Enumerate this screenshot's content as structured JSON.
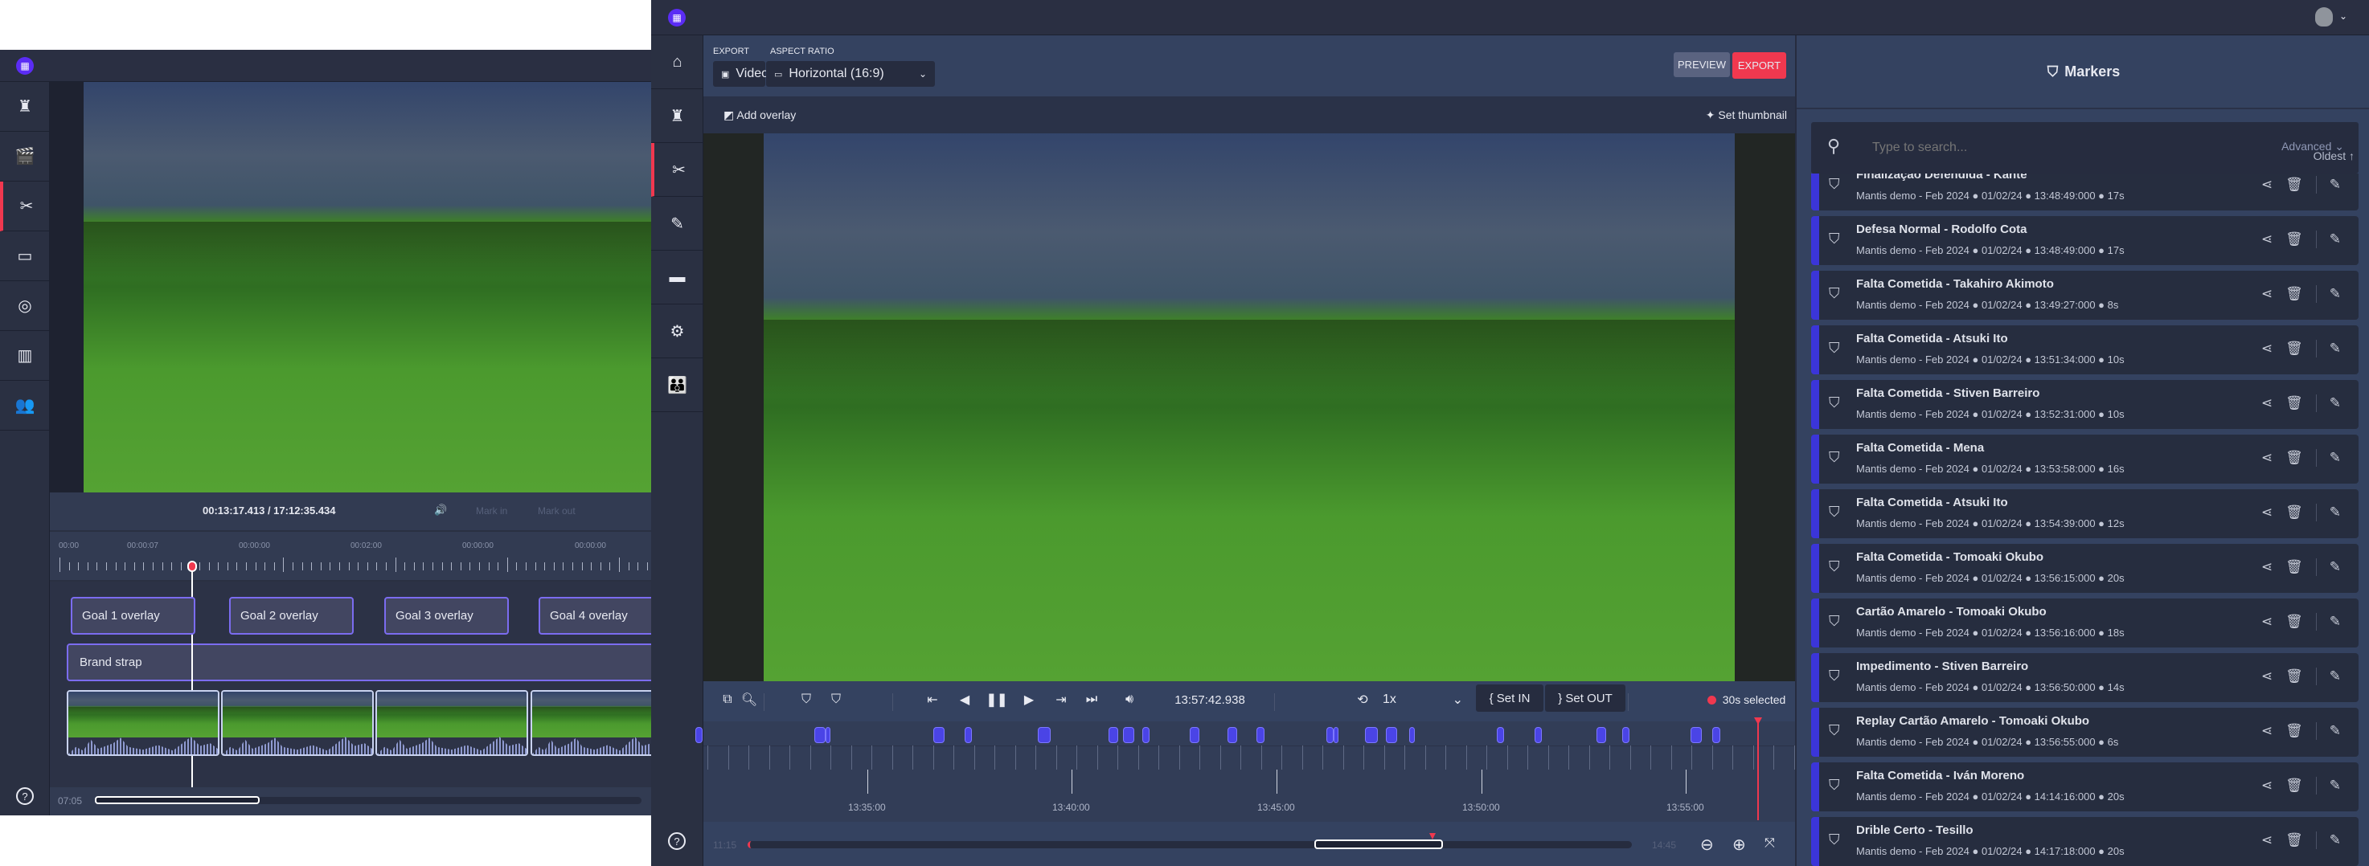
{
  "colors": {
    "accent": "#5b2cf5",
    "export": "#f0384f",
    "marker": "#4a44e6",
    "overlay_border": "#7b6cf0",
    "playhead": "#f0384f"
  },
  "left_app": {
    "sidebar": [
      {
        "icon": "director-chair-icon",
        "glyph": "♜"
      },
      {
        "icon": "clapperboard-icon",
        "glyph": "🎬"
      },
      {
        "icon": "clip-edit-icon",
        "glyph": "✂",
        "active": true
      },
      {
        "icon": "folder-icon",
        "glyph": "▭"
      },
      {
        "icon": "play-settings-icon",
        "glyph": "◎"
      },
      {
        "icon": "chart-icon",
        "glyph": "▥"
      },
      {
        "icon": "users-icon",
        "glyph": "👥"
      }
    ],
    "time_display": "00:13:17.413 / 17:12:35.434",
    "mark_in": "Mark in",
    "mark_out": "Mark out",
    "ruler_labels": [
      "00:00",
      "00:00:07",
      "00:00:00",
      "00:02:00",
      "00:00:00",
      "00:00:00"
    ],
    "overlays": [
      "Goal 1 overlay",
      "Goal 2 overlay",
      "Goal 3 overlay",
      "Goal 4 overlay"
    ],
    "brand_strap": "Brand strap",
    "scroll_start": "07:05",
    "help": "?"
  },
  "right_app": {
    "sidebar": [
      {
        "icon": "home-icon",
        "glyph": "⌂"
      },
      {
        "icon": "director-chair-icon",
        "glyph": "♜"
      },
      {
        "icon": "scissors-icon",
        "glyph": "✂",
        "active": true
      },
      {
        "icon": "edit-notebook-icon",
        "glyph": "✎"
      },
      {
        "icon": "folder-icon",
        "glyph": "▬"
      },
      {
        "icon": "video-settings-icon",
        "glyph": "⚙"
      },
      {
        "icon": "team-icon",
        "glyph": "👪"
      }
    ],
    "export_label": "EXPORT",
    "export_value": "Video",
    "aspect_label": "ASPECT RATIO",
    "aspect_value": "Horizontal (16:9)",
    "preview": "PREVIEW",
    "export_button": "EXPORT",
    "add_overlay": "Add overlay",
    "set_thumbnail": "Set thumbnail",
    "timecode": "13:57:42.938",
    "speed": "1x",
    "set_in": "Set IN",
    "set_out": "Set OUT",
    "selected": "30s selected",
    "timeline_labels": [
      "13:35:00",
      "13:40:00",
      "13:45:00",
      "13:50:00",
      "13:55:00"
    ],
    "scroll_start": "11:15",
    "scroll_end": "14:45",
    "help": "?"
  },
  "markers_panel": {
    "title": "Markers",
    "search_placeholder": "Type to search...",
    "advanced": "Advanced",
    "sort": "Oldest ↑",
    "items": [
      {
        "title": "Finalização Defendida - Kanté",
        "meta": "Mantis demo - Feb 2024 ● 01/02/24 ● 13:48:49:000 ●  17s"
      },
      {
        "title": "Defesa Normal - Rodolfo Cota",
        "meta": "Mantis demo - Feb 2024 ● 01/02/24 ● 13:48:49:000 ●  17s"
      },
      {
        "title": "Falta Cometida - Takahiro Akimoto",
        "meta": "Mantis demo - Feb 2024 ● 01/02/24 ● 13:49:27:000 ●  8s"
      },
      {
        "title": "Falta Cometida - Atsuki Ito",
        "meta": "Mantis demo - Feb 2024 ● 01/02/24 ● 13:51:34:000 ●  10s"
      },
      {
        "title": "Falta Cometida - Stiven Barreiro",
        "meta": "Mantis demo - Feb 2024 ● 01/02/24 ● 13:52:31:000 ●  10s"
      },
      {
        "title": "Falta Cometida - Mena",
        "meta": "Mantis demo - Feb 2024 ● 01/02/24 ● 13:53:58:000 ●  16s"
      },
      {
        "title": "Falta Cometida - Atsuki Ito",
        "meta": "Mantis demo - Feb 2024 ● 01/02/24 ● 13:54:39:000 ●  12s"
      },
      {
        "title": "Falta Cometida - Tomoaki Okubo",
        "meta": "Mantis demo - Feb 2024 ● 01/02/24 ● 13:56:15:000 ●  20s"
      },
      {
        "title": "Cartão Amarelo - Tomoaki Okubo",
        "meta": "Mantis demo - Feb 2024 ● 01/02/24 ● 13:56:16:000 ●  18s"
      },
      {
        "title": "Impedimento - Stiven Barreiro",
        "meta": "Mantis demo - Feb 2024 ● 01/02/24 ● 13:56:50:000 ●  14s"
      },
      {
        "title": "Replay Cartão Amarelo - Tomoaki Okubo",
        "meta": "Mantis demo - Feb 2024 ● 01/02/24 ● 13:56:55:000 ●  6s"
      },
      {
        "title": "Falta Cometida - Iván Moreno",
        "meta": "Mantis demo - Feb 2024 ● 01/02/24 ● 14:14:16:000 ●  20s"
      },
      {
        "title": "Drible Certo - Tesillo",
        "meta": "Mantis demo - Feb 2024 ● 01/02/24 ● 14:17:18:000 ●  20s"
      }
    ]
  }
}
